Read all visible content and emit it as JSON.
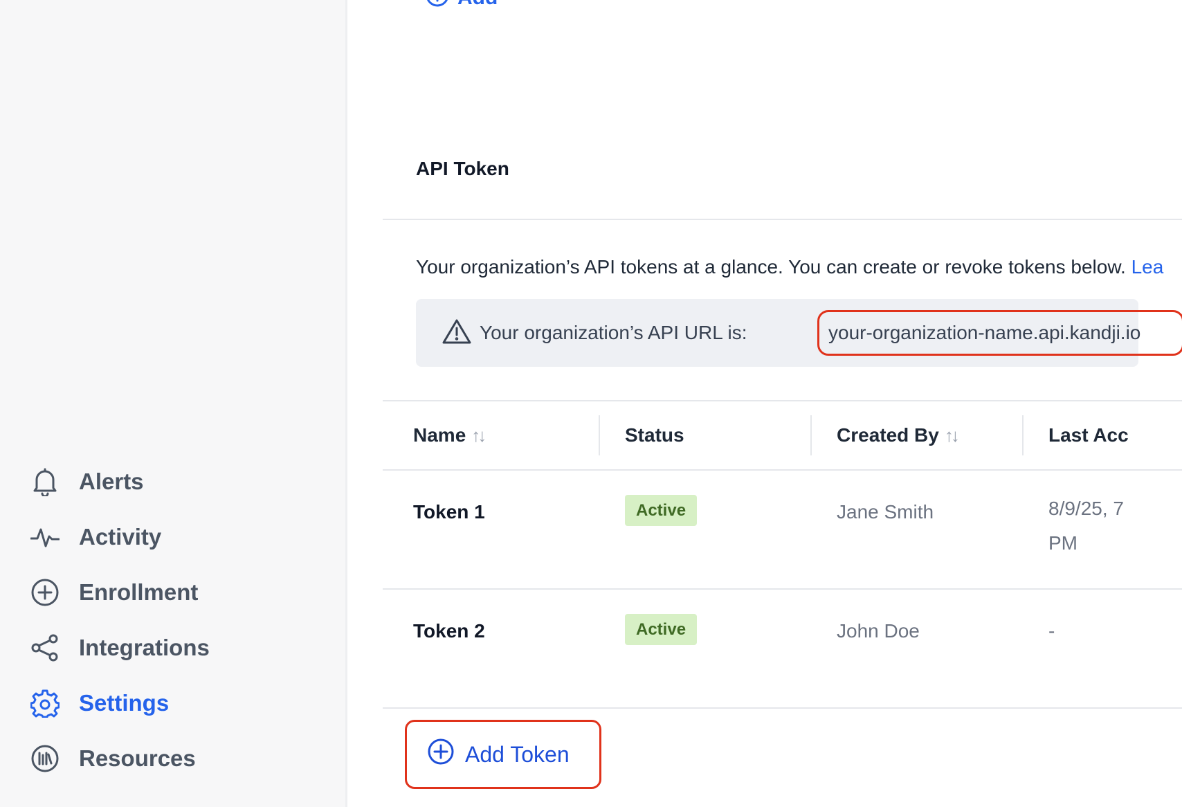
{
  "sidebar": {
    "items": [
      {
        "label": "Alerts",
        "icon": "bell-icon"
      },
      {
        "label": "Activity",
        "icon": "activity-icon"
      },
      {
        "label": "Enrollment",
        "icon": "plus-circle-icon"
      },
      {
        "label": "Integrations",
        "icon": "share-nodes-icon"
      },
      {
        "label": "Settings",
        "icon": "gear-icon",
        "active": true
      },
      {
        "label": "Resources",
        "icon": "library-icon"
      }
    ]
  },
  "top_action": {
    "label": "Add"
  },
  "api_token": {
    "title": "API Token",
    "intro": "Your organization’s API tokens at a glance. You can create or revoke tokens below.",
    "learn_more": "Lea",
    "url_label": "Your organization’s API URL is:",
    "url_value": "your-organization-name.api.kandji.io"
  },
  "table": {
    "columns": [
      "Name",
      "Status",
      "Created By",
      "Last Acc"
    ],
    "rows": [
      {
        "name": "Token 1",
        "status": "Active",
        "created_by": "Jane Smith",
        "last_accessed": "8/9/25, 7 PM"
      },
      {
        "name": "Token 2",
        "status": "Active",
        "created_by": "John Doe",
        "last_accessed": "-"
      }
    ]
  },
  "add_token": {
    "label": "Add Token"
  },
  "colors": {
    "accent": "#2563eb",
    "highlight": "#e0321b",
    "badge_bg": "#d7f0c5",
    "badge_text": "#3f6a24"
  }
}
